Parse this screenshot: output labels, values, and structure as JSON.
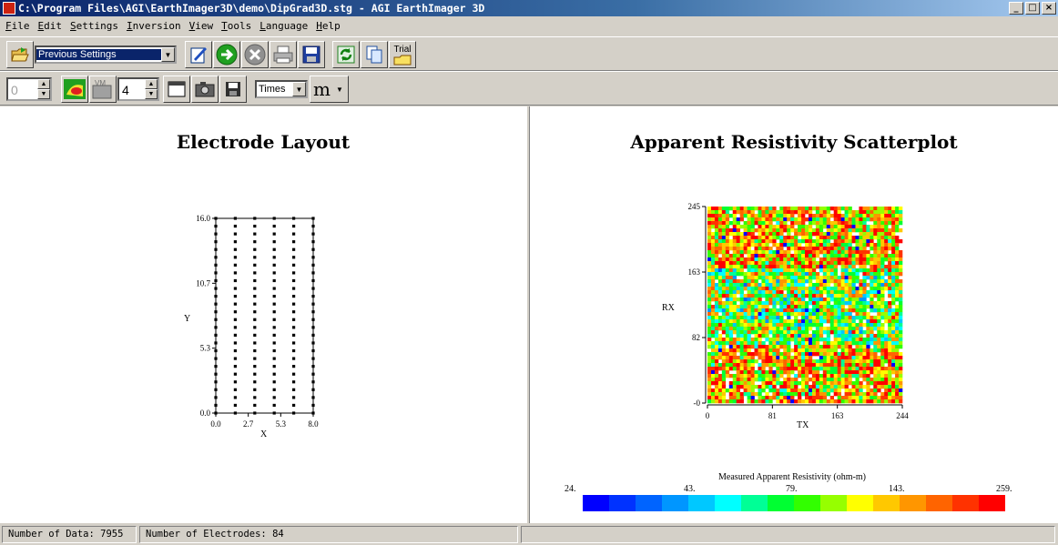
{
  "window": {
    "title": "C:\\Program Files\\AGI\\EarthImager3D\\demo\\DipGrad3D.stg - AGI EarthImager 3D",
    "buttons": [
      "_",
      "□",
      "×"
    ]
  },
  "menu": [
    "File",
    "Edit",
    "Settings",
    "Inversion",
    "View",
    "Tools",
    "Language",
    "Help"
  ],
  "toolbar1": {
    "settings_combo": "Previous Settings",
    "trial_label": "Trial",
    "icons": [
      "open-folder-icon",
      "edit-icon",
      "run-icon",
      "stop-icon",
      "print-icon",
      "save-icon",
      "refresh-icon",
      "copy-icon",
      "trial-icon"
    ]
  },
  "toolbar2": {
    "spin1_value": "0",
    "spin2_value": "4",
    "font_combo": "Times",
    "unit_button": "m",
    "vm_label": "VM"
  },
  "left_panel": {
    "title": "Electrode Layout",
    "xlabel": "X",
    "ylabel": "Y",
    "xticks": [
      "0.0",
      "2.7",
      "5.3",
      "8.0"
    ],
    "yticks": [
      "0.0",
      "5.3",
      "10.7",
      "16.0"
    ]
  },
  "right_panel": {
    "title": "Apparent Resistivity Scatterplot",
    "xlabel": "TX",
    "ylabel": "RX",
    "xticks": [
      "0",
      "81",
      "163",
      "244"
    ],
    "yticks": [
      "-0",
      "82",
      "163",
      "245"
    ],
    "colorbar_title": "Measured Apparent Resistivity (ohm-m)",
    "colorbar_ticks": [
      "24.",
      "43.",
      "79.",
      "143.",
      "259."
    ],
    "colorbar_colors": [
      "#0000ff",
      "#0032ff",
      "#0064ff",
      "#0096ff",
      "#00c8ff",
      "#00ffff",
      "#00ff96",
      "#00ff32",
      "#32ff00",
      "#96ff00",
      "#ffff00",
      "#ffc800",
      "#ff9600",
      "#ff6400",
      "#ff3200",
      "#ff0000"
    ]
  },
  "chart_data": [
    {
      "type": "scatter",
      "title": "Electrode Layout",
      "xlabel": "X",
      "ylabel": "Y",
      "xlim": [
        0,
        8
      ],
      "ylim": [
        0,
        16
      ],
      "x_columns": [
        0,
        1.6,
        3.2,
        4.8,
        6.4,
        8.0
      ],
      "y_rows": [
        0,
        0.64,
        1.28,
        1.92,
        2.56,
        3.2,
        3.84,
        4.48,
        5.12,
        5.76,
        6.4,
        7.04,
        7.68,
        8.32,
        8.96,
        9.6,
        10.24,
        10.88,
        11.52,
        12.16,
        12.8,
        13.44,
        14.08,
        14.72,
        15.36,
        16.0
      ]
    },
    {
      "type": "scatter",
      "title": "Apparent Resistivity Scatterplot",
      "xlabel": "TX",
      "ylabel": "RX",
      "xlim": [
        0,
        244
      ],
      "ylim": [
        0,
        245
      ],
      "legend": "bottom colorbar",
      "color_range": [
        24,
        259
      ]
    }
  ],
  "status": {
    "data_count": "Number of Data: 7955",
    "electrodes": "Number of Electrodes: 84"
  }
}
